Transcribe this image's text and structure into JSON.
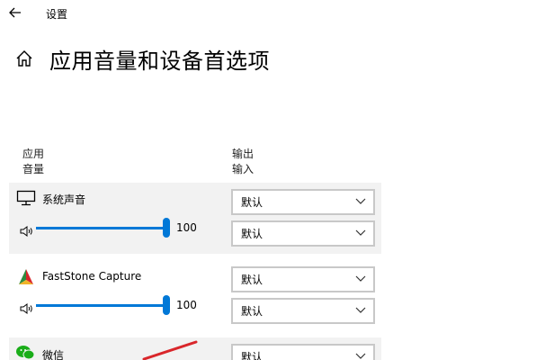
{
  "window": {
    "title": "设置"
  },
  "page": {
    "title": "应用音量和设备首选项"
  },
  "columns": {
    "app_line1": "应用",
    "app_line2": "音量",
    "out_line1": "输出",
    "out_line2": "输入"
  },
  "apps": [
    {
      "name": "系统声音",
      "icon": "monitor-icon",
      "volume": "100",
      "volume_level": 100,
      "output": "默认",
      "input": "默认"
    },
    {
      "name": "FastStone Capture",
      "icon": "faststone-icon",
      "volume": "100",
      "volume_level": 100,
      "output": "默认",
      "input": "默认"
    },
    {
      "name": "微信",
      "icon": "wechat-icon",
      "output": "默认"
    }
  ],
  "colors": {
    "accent": "#0078d7",
    "row_background": "#f2f2f2",
    "wechat_green": "#1aad19",
    "annotation_red": "#d9262b"
  }
}
